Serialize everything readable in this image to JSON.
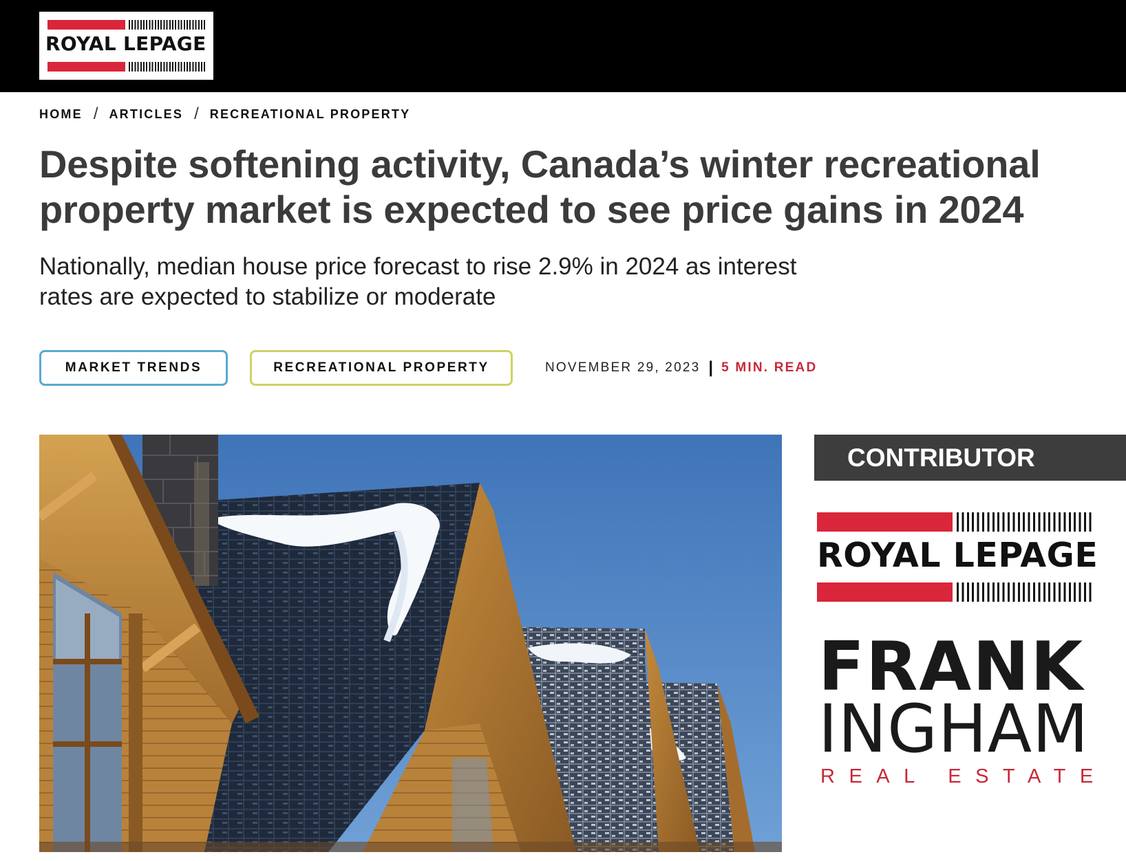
{
  "header": {
    "logo_text": "ROYAL LEPAGE"
  },
  "breadcrumb": {
    "items": [
      "HOME",
      "ARTICLES",
      "RECREATIONAL PROPERTY"
    ],
    "separator": "/"
  },
  "article": {
    "title": "Despite softening activity, Canada’s winter recreational property market is expected to see price gains in 2024",
    "subtitle": "Nationally, median house price forecast to rise 2.9% in 2024 as interest rates are expected to stabilize or moderate",
    "tags": [
      "MARKET TRENDS",
      "RECREATIONAL PROPERTY"
    ],
    "date": "NOVEMBER 29, 2023",
    "meta_separator": "|",
    "read_time": "5 MIN. READ"
  },
  "contributor": {
    "heading": "CONTRIBUTOR",
    "brand_logo_text": "ROYAL LEPAGE",
    "name_line1": "FRANK",
    "name_line2": "INGHAM",
    "tagline": "REAL ESTATE"
  },
  "colors": {
    "brand_red": "#d9263a",
    "market_tag_border": "#5aa9cf",
    "rec_tag_border": "#cdd365",
    "read_time": "#c8283a",
    "contributor_bg": "#3d3d3d",
    "sky": "#4a7fbf"
  }
}
